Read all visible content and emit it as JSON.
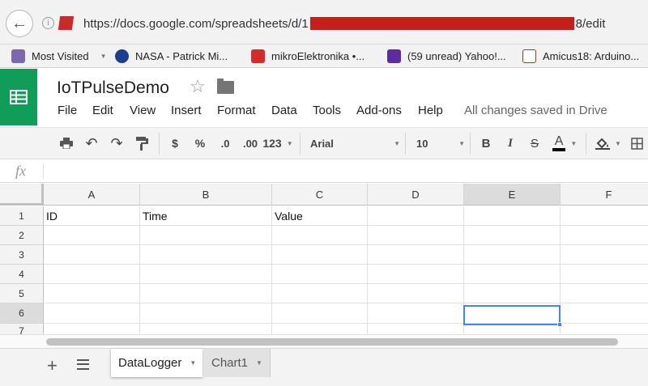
{
  "browser": {
    "url_prefix": "https://docs.google.com/spreadsheets/d/1",
    "url_suffix": "8/edit",
    "bookmarks": [
      {
        "label": "Most Visited",
        "icon": "most-visited-icon",
        "color": "#7b68ae"
      },
      {
        "label": "NASA - Patrick Mi...",
        "icon": "nasa-icon",
        "color": "#1b3f8f"
      },
      {
        "label": "mikroElektronika •...",
        "icon": "mikroelektronika-icon",
        "color": "#d62b2b"
      },
      {
        "label": "(59 unread) Yahoo!...",
        "icon": "yahoo-icon",
        "color": "#5f2a9e"
      },
      {
        "label": "Amicus18: Arduino...",
        "icon": "amicus-icon",
        "color": "#c4281c"
      }
    ]
  },
  "doc": {
    "title": "IoTPulseDemo",
    "menu": [
      "File",
      "Edit",
      "View",
      "Insert",
      "Format",
      "Data",
      "Tools",
      "Add-ons",
      "Help"
    ],
    "status": "All changes saved in Drive"
  },
  "toolbar": {
    "currency": "$",
    "percent": "%",
    "decrease_decimal": ".0",
    "increase_decimal": ".00",
    "more_formats": "123",
    "font": "Arial",
    "font_size": "10",
    "bold": "B",
    "italic": "I",
    "strike": "S",
    "text_color": "A"
  },
  "formula": {
    "symbol": "fx",
    "value": ""
  },
  "grid": {
    "columns": [
      "A",
      "B",
      "C",
      "D",
      "E",
      "F"
    ],
    "rows": [
      "1",
      "2",
      "3",
      "4",
      "5",
      "6",
      "7"
    ],
    "cells": {
      "A1": "ID",
      "B1": "Time",
      "C1": "Value"
    },
    "selected_cell": "E6"
  },
  "sheets": [
    {
      "name": "DataLogger",
      "active": true
    },
    {
      "name": "Chart1",
      "active": false
    }
  ],
  "colors": {
    "accent": "#0f9d58",
    "selection": "#4285f4"
  }
}
